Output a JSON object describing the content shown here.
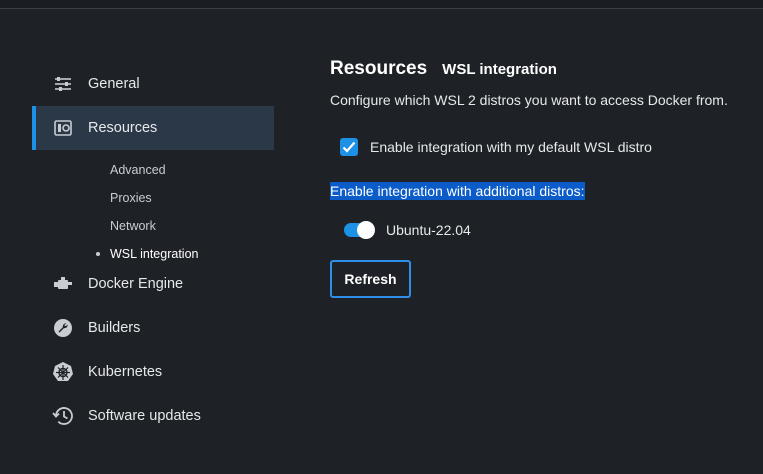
{
  "sidebar": {
    "items": [
      {
        "label": "General",
        "icon": "sliders-icon"
      },
      {
        "label": "Resources",
        "icon": "resources-icon"
      },
      {
        "label": "Docker Engine",
        "icon": "engine-icon"
      },
      {
        "label": "Builders",
        "icon": "wrench-icon"
      },
      {
        "label": "Kubernetes",
        "icon": "helm-icon"
      },
      {
        "label": "Software updates",
        "icon": "history-icon"
      }
    ],
    "sub_items": [
      {
        "label": "Advanced"
      },
      {
        "label": "Proxies"
      },
      {
        "label": "Network"
      },
      {
        "label": "WSL integration"
      }
    ]
  },
  "main": {
    "title": "Resources",
    "subtitle": "WSL integration",
    "description": "Configure which WSL 2 distros you want to access Docker from.",
    "default_distro_label": "Enable integration with my default WSL distro",
    "default_distro_checked": true,
    "additional_label": "Enable integration with additional distros:",
    "distros": [
      {
        "name": "Ubuntu-22.04",
        "enabled": true
      }
    ],
    "refresh_label": "Refresh"
  },
  "colors": {
    "accent": "#1d91e6",
    "background": "#1e2226",
    "active_item": "#2a3848",
    "selection": "#0b5cc9"
  }
}
